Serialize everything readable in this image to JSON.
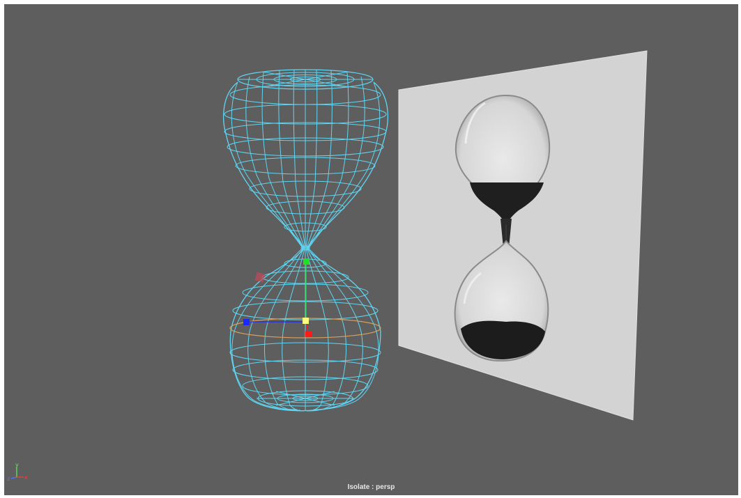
{
  "viewport": {
    "camera_label": "Isolate : persp",
    "background_color": "#5e5e5e"
  },
  "scene": {
    "wireframe_color": "#5fd6f3",
    "selected_ring_color": "#d9a15a",
    "image_plane_color": "#d3d3d3",
    "objects": [
      "hourglass-wireframe-mesh",
      "reference-image-plane"
    ]
  },
  "manipulator": {
    "x_axis_color": "#ff1a1a",
    "y_axis_color": "#22e022",
    "z_axis_color": "#1a2aff",
    "center_color": "#ffff80",
    "rotate_handle_color": "#c24a5a"
  },
  "axis_gizmo": {
    "x_label": "x",
    "y_label": "y",
    "z_label": "z",
    "x_color": "#ff3a3a",
    "y_color": "#5cf05c",
    "z_color": "#4b7bff"
  }
}
